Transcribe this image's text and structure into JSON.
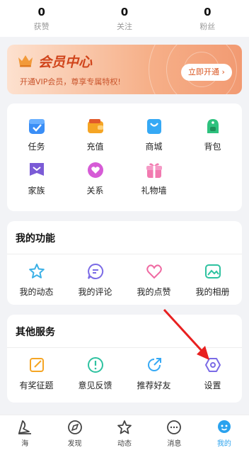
{
  "stats": [
    {
      "value": "0",
      "label": "获赞"
    },
    {
      "value": "0",
      "label": "关注"
    },
    {
      "value": "0",
      "label": "粉丝"
    }
  ],
  "vip": {
    "title": "会员中心",
    "subtitle": "开通VIP会员，尊享专属特权!",
    "button": "立即开通 ›"
  },
  "services": [
    {
      "label": "任务",
      "icon": "task-icon",
      "color": "#3a8ef6"
    },
    {
      "label": "充值",
      "icon": "wallet-icon",
      "color": "#f5a524"
    },
    {
      "label": "商城",
      "icon": "shopping-bag-icon",
      "color": "#36a9f5"
    },
    {
      "label": "背包",
      "icon": "backpack-icon",
      "color": "#2ec27e"
    },
    {
      "label": "家族",
      "icon": "family-banner-icon",
      "color": "#7b5bd6"
    },
    {
      "label": "关系",
      "icon": "heart-icon",
      "color": "#d65bd6"
    },
    {
      "label": "礼物墙",
      "icon": "gift-icon",
      "color": "#f27ab0"
    }
  ],
  "my_functions": {
    "title": "我的功能",
    "items": [
      {
        "label": "我的动态",
        "icon": "star-icon",
        "color": "#3ab0e6"
      },
      {
        "label": "我的评论",
        "icon": "comment-icon",
        "color": "#7b6be6"
      },
      {
        "label": "我的点赞",
        "icon": "like-heart-icon",
        "color": "#ef6aa2"
      },
      {
        "label": "我的相册",
        "icon": "album-icon",
        "color": "#2ec2a0"
      }
    ]
  },
  "other_services": {
    "title": "其他服务",
    "items": [
      {
        "label": "有奖征题",
        "icon": "edit-icon",
        "color": "#f5a524"
      },
      {
        "label": "意见反馈",
        "icon": "feedback-icon",
        "color": "#2ec2a0"
      },
      {
        "label": "推荐好友",
        "icon": "share-icon",
        "color": "#36a9f5"
      },
      {
        "label": "设置",
        "icon": "settings-hexagon-icon",
        "color": "#7b6be6"
      }
    ]
  },
  "tabbar": [
    {
      "label": "海",
      "icon": "sea-icon"
    },
    {
      "label": "发现",
      "icon": "compass-icon"
    },
    {
      "label": "动态",
      "icon": "star-outline-icon"
    },
    {
      "label": "消息",
      "icon": "message-icon"
    },
    {
      "label": "我的",
      "icon": "profile-icon",
      "active": true
    }
  ],
  "colors": {
    "accent": "#2aa2ee",
    "annotation_arrow": "#e82020",
    "vip_title": "#d0441b"
  }
}
